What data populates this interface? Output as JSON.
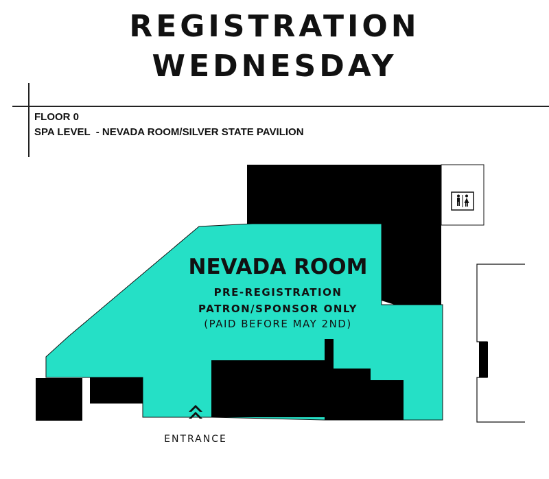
{
  "title": {
    "line1": "REGISTRATION",
    "line2": "WEDNESDAY"
  },
  "floor": {
    "level": "FLOOR 0",
    "location": "SPA LEVEL  - NEVADA ROOM/SILVER STATE PAVILION"
  },
  "room": {
    "name": "NEVADA ROOM",
    "line1": "PRE-REGISTRATION",
    "line2": "PATRON/SPONSOR ONLY",
    "line3": "(PAID BEFORE MAY 2ND)"
  },
  "entrance": {
    "label": "ENTRANCE",
    "icon": "chevron-up-icon"
  },
  "restroom": {
    "icon": "restroom-icon"
  },
  "colors": {
    "room_fill": "#25e0c6",
    "blocked": "#000000",
    "background": "#ffffff"
  }
}
